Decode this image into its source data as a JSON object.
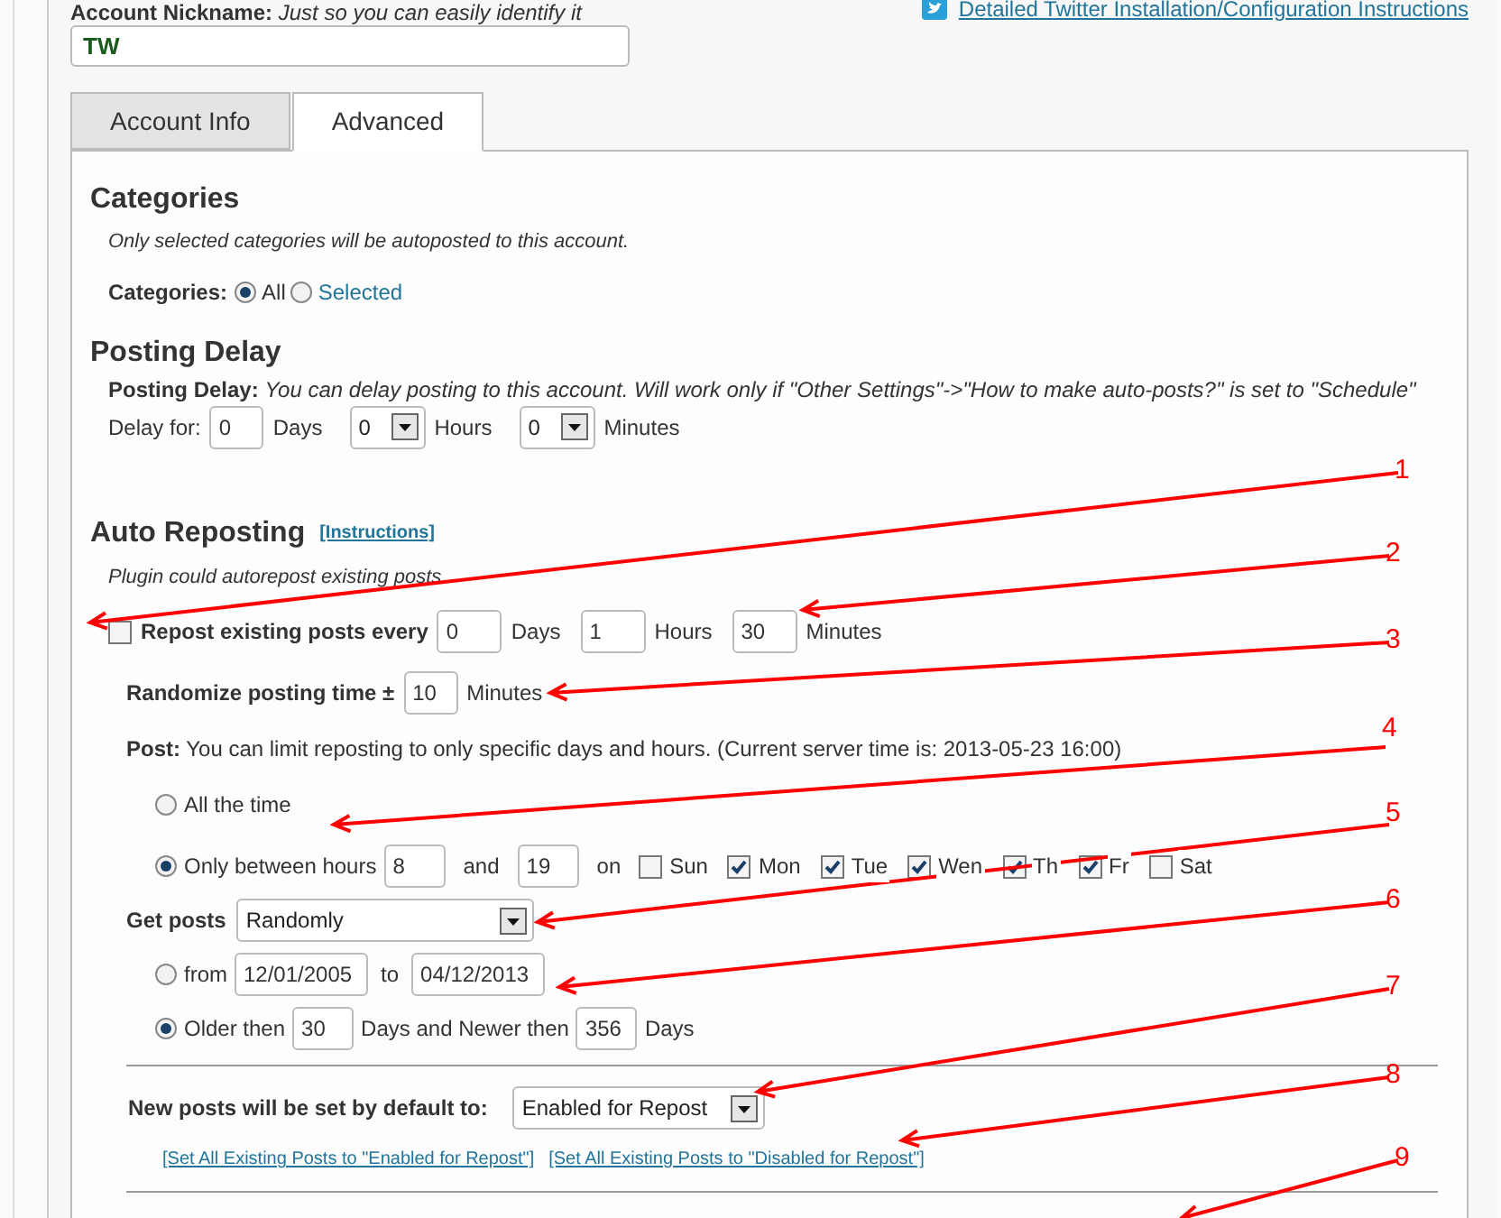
{
  "header": {
    "nickname_label": "Account Nickname:",
    "nickname_hint": "Just so you can easily identify it",
    "nickname_value": "TW",
    "instructions_link": "Detailed Twitter Installation/Configuration Instructions"
  },
  "tabs": [
    {
      "label": "Account Info",
      "selected": false
    },
    {
      "label": "Advanced",
      "selected": true
    }
  ],
  "categories": {
    "title": "Categories",
    "note": "Only selected categories will be autoposted to this account.",
    "label": "Categories:",
    "options": [
      {
        "label": "All",
        "selected": true
      },
      {
        "label": "Selected",
        "selected": false
      }
    ]
  },
  "posting_delay": {
    "title": "Posting Delay",
    "label": "Posting Delay:",
    "note": "You can delay posting to this account. Will work only if \"Other Settings\"->\"How to make auto-posts?\" is set to \"Schedule\"",
    "delay_label": "Delay for:",
    "fields": [
      {
        "kind": "input",
        "value": "0",
        "unit": "Days"
      },
      {
        "kind": "select",
        "value": "0",
        "unit": "Hours"
      },
      {
        "kind": "select",
        "value": "0",
        "unit": "Minutes"
      }
    ]
  },
  "auto_reposting": {
    "title": "Auto Reposting",
    "instructions_link": "[Instructions]",
    "note": "Plugin could autorepost existing posts",
    "repost": {
      "checked": false,
      "label": "Repost existing posts every",
      "fields": [
        {
          "value": "0",
          "unit": "Days"
        },
        {
          "value": "1",
          "unit": "Hours"
        },
        {
          "value": "30",
          "unit": "Minutes"
        }
      ]
    },
    "randomize": {
      "label": "Randomize posting time ±",
      "value": "10",
      "unit": "Minutes"
    },
    "post": {
      "label": "Post:",
      "note": "You can limit reposting to only specific days and hours. (Current server time is: 2013-05-23 16:00)"
    },
    "schedule": [
      {
        "kind": "always",
        "label": "All the time",
        "selected": false
      },
      {
        "kind": "hours",
        "label": "Only between hours",
        "selected": true,
        "from": "8",
        "and": "and",
        "to": "19",
        "on": "on",
        "days": [
          {
            "label": "Sun",
            "checked": false
          },
          {
            "label": "Mon",
            "checked": true
          },
          {
            "label": "Tue",
            "checked": true
          },
          {
            "label": "Wen",
            "checked": true
          },
          {
            "label": "Th",
            "checked": true
          },
          {
            "label": "Fr",
            "checked": true
          },
          {
            "label": "Sat",
            "checked": false
          }
        ]
      }
    ],
    "get_posts": {
      "label": "Get posts",
      "value": "Randomly"
    },
    "ranges": [
      {
        "kind": "dates",
        "label": "from",
        "selected": false,
        "from": "12/01/2005",
        "to_label": "to",
        "to": "04/12/2013"
      },
      {
        "kind": "age",
        "label": "Older then",
        "selected": true,
        "value": "30",
        "middle": "Days and Newer then",
        "value2": "356",
        "unit": "Days"
      }
    ],
    "default": {
      "label": "New posts will be set by default to:",
      "value": "Enabled for Repost"
    },
    "links": [
      "[Set All Existing Posts to \"Enabled for Repost\"]",
      "[Set All Existing Posts to \"Disabled for Repost\"]"
    ]
  },
  "annotations": [
    "1",
    "2",
    "3",
    "4",
    "5",
    "6",
    "7",
    "8",
    "9"
  ]
}
